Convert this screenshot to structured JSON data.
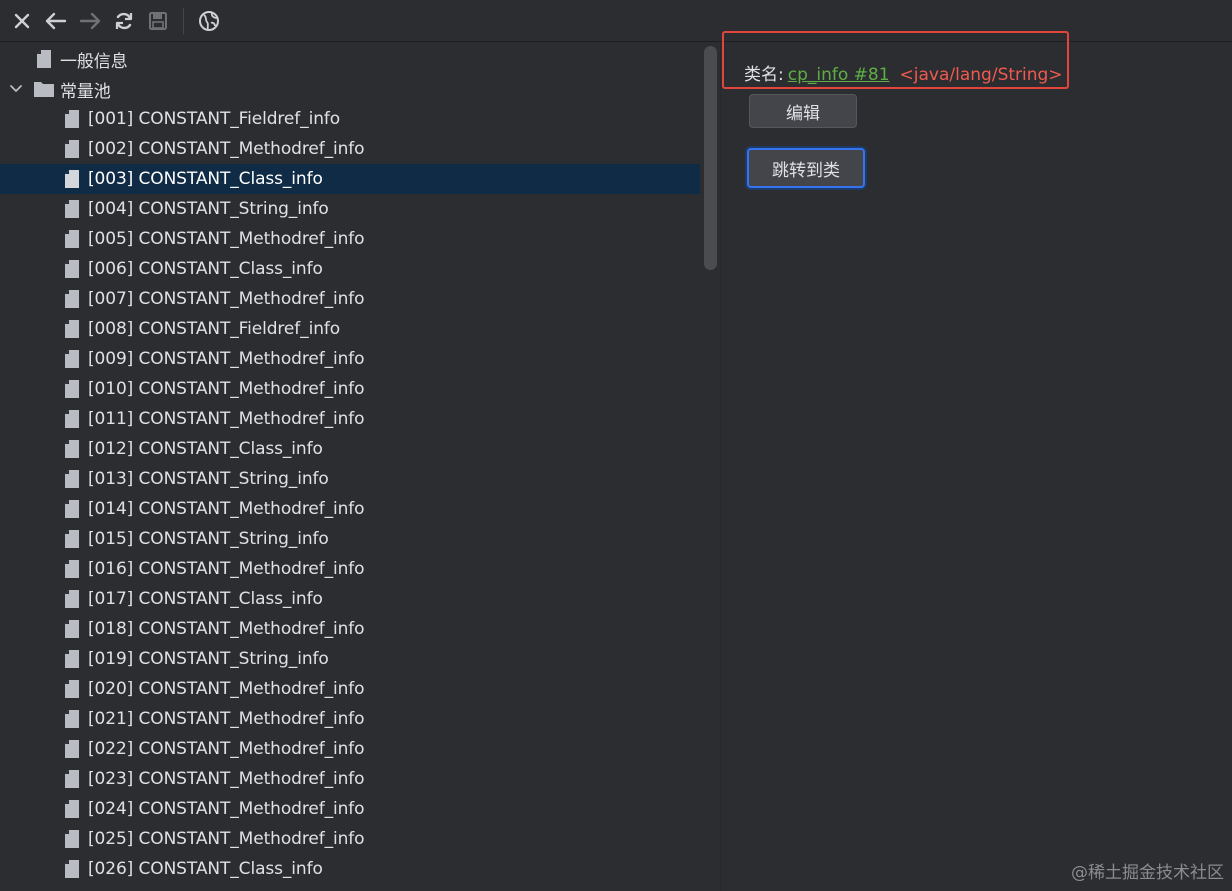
{
  "toolbar": {
    "buttons": [
      {
        "name": "close-icon"
      },
      {
        "name": "back-arrow-icon"
      },
      {
        "name": "forward-arrow-icon"
      },
      {
        "name": "refresh-icon"
      },
      {
        "name": "save-icon"
      },
      {
        "name": "globe-icon"
      }
    ]
  },
  "tree": {
    "general_info": "一般信息",
    "constant_pool": "常量池",
    "items": [
      "[001] CONSTANT_Fieldref_info",
      "[002] CONSTANT_Methodref_info",
      "[003] CONSTANT_Class_info",
      "[004] CONSTANT_String_info",
      "[005] CONSTANT_Methodref_info",
      "[006] CONSTANT_Class_info",
      "[007] CONSTANT_Methodref_info",
      "[008] CONSTANT_Fieldref_info",
      "[009] CONSTANT_Methodref_info",
      "[010] CONSTANT_Methodref_info",
      "[011] CONSTANT_Methodref_info",
      "[012] CONSTANT_Class_info",
      "[013] CONSTANT_String_info",
      "[014] CONSTANT_Methodref_info",
      "[015] CONSTANT_String_info",
      "[016] CONSTANT_Methodref_info",
      "[017] CONSTANT_Class_info",
      "[018] CONSTANT_Methodref_info",
      "[019] CONSTANT_String_info",
      "[020] CONSTANT_Methodref_info",
      "[021] CONSTANT_Methodref_info",
      "[022] CONSTANT_Methodref_info",
      "[023] CONSTANT_Methodref_info",
      "[024] CONSTANT_Methodref_info",
      "[025] CONSTANT_Methodref_info",
      "[026] CONSTANT_Class_info"
    ],
    "selected_index": 2
  },
  "detail": {
    "class_label": "类名:",
    "class_link": "cp_info #81",
    "class_path": "<java/lang/String>",
    "edit_button": "编辑",
    "jump_button": "跳转到类"
  },
  "watermark": "@稀土掘金技术社区",
  "colors": {
    "background": "#2b2d30",
    "selection": "#0f2b45",
    "link_green": "#5fae45",
    "path_red": "#f05a4f",
    "highlight_border": "#e2453c",
    "focus_blue": "#3574f0"
  }
}
